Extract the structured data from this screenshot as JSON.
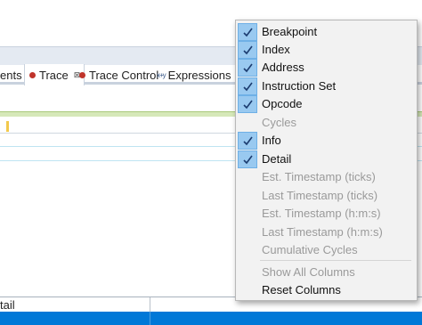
{
  "tabs": [
    {
      "label": "ents",
      "icon": "none",
      "active": false
    },
    {
      "label": "Trace",
      "icon": "trace-icon",
      "active": true,
      "close": "⊠"
    },
    {
      "label": "Trace Control",
      "icon": "trace-icon",
      "active": false
    },
    {
      "label": "Expressions",
      "icon": "expressions-icon",
      "active": false
    }
  ],
  "detail_panel": {
    "column_header": "tail"
  },
  "context_menu": {
    "items": [
      {
        "label": "Breakpoint",
        "checked": true,
        "enabled": true
      },
      {
        "label": "Index",
        "checked": true,
        "enabled": true
      },
      {
        "label": "Address",
        "checked": true,
        "enabled": true
      },
      {
        "label": "Instruction Set",
        "checked": true,
        "enabled": true
      },
      {
        "label": "Opcode",
        "checked": true,
        "enabled": true
      },
      {
        "label": "Cycles",
        "checked": false,
        "enabled": false
      },
      {
        "label": "Info",
        "checked": true,
        "enabled": true
      },
      {
        "label": "Detail",
        "checked": true,
        "enabled": true
      },
      {
        "label": "Est. Timestamp (ticks)",
        "checked": false,
        "enabled": false
      },
      {
        "label": "Last Timestamp (ticks)",
        "checked": false,
        "enabled": false
      },
      {
        "label": "Est. Timestamp (h:m:s)",
        "checked": false,
        "enabled": false
      },
      {
        "label": "Last Timestamp (h:m:s)",
        "checked": false,
        "enabled": false
      },
      {
        "label": "Cumulative Cycles",
        "checked": false,
        "enabled": false
      },
      {
        "label": "Show All Columns",
        "checked": false,
        "enabled": false
      },
      {
        "label": "Reset Columns",
        "checked": false,
        "enabled": true
      }
    ]
  },
  "colors": {
    "accent_blue": "#0078d7",
    "check_highlight": "#99c9f0",
    "trace_icon": "#c0342b"
  }
}
